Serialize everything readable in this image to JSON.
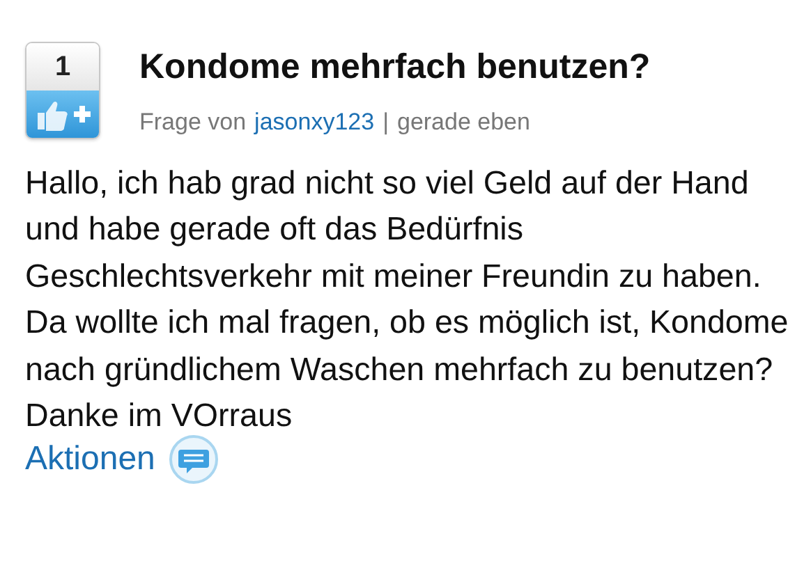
{
  "vote": {
    "count": "1"
  },
  "question": {
    "title": "Kondome mehrfach benutzen?",
    "prefix": "Frage von",
    "author": "jasonxy123",
    "separator": "|",
    "time": "gerade eben",
    "body": "Hallo, ich hab grad nicht so viel Geld auf der Hand und habe gerade oft das Bedürfnis Geschlechtsverkehr mit meiner Freundin zu haben. Da wollte ich mal fragen, ob es möglich ist, Kondome nach gründlichem Waschen mehrfach zu benutzen? Danke im VOrraus"
  },
  "actions": {
    "label": "Aktionen"
  }
}
